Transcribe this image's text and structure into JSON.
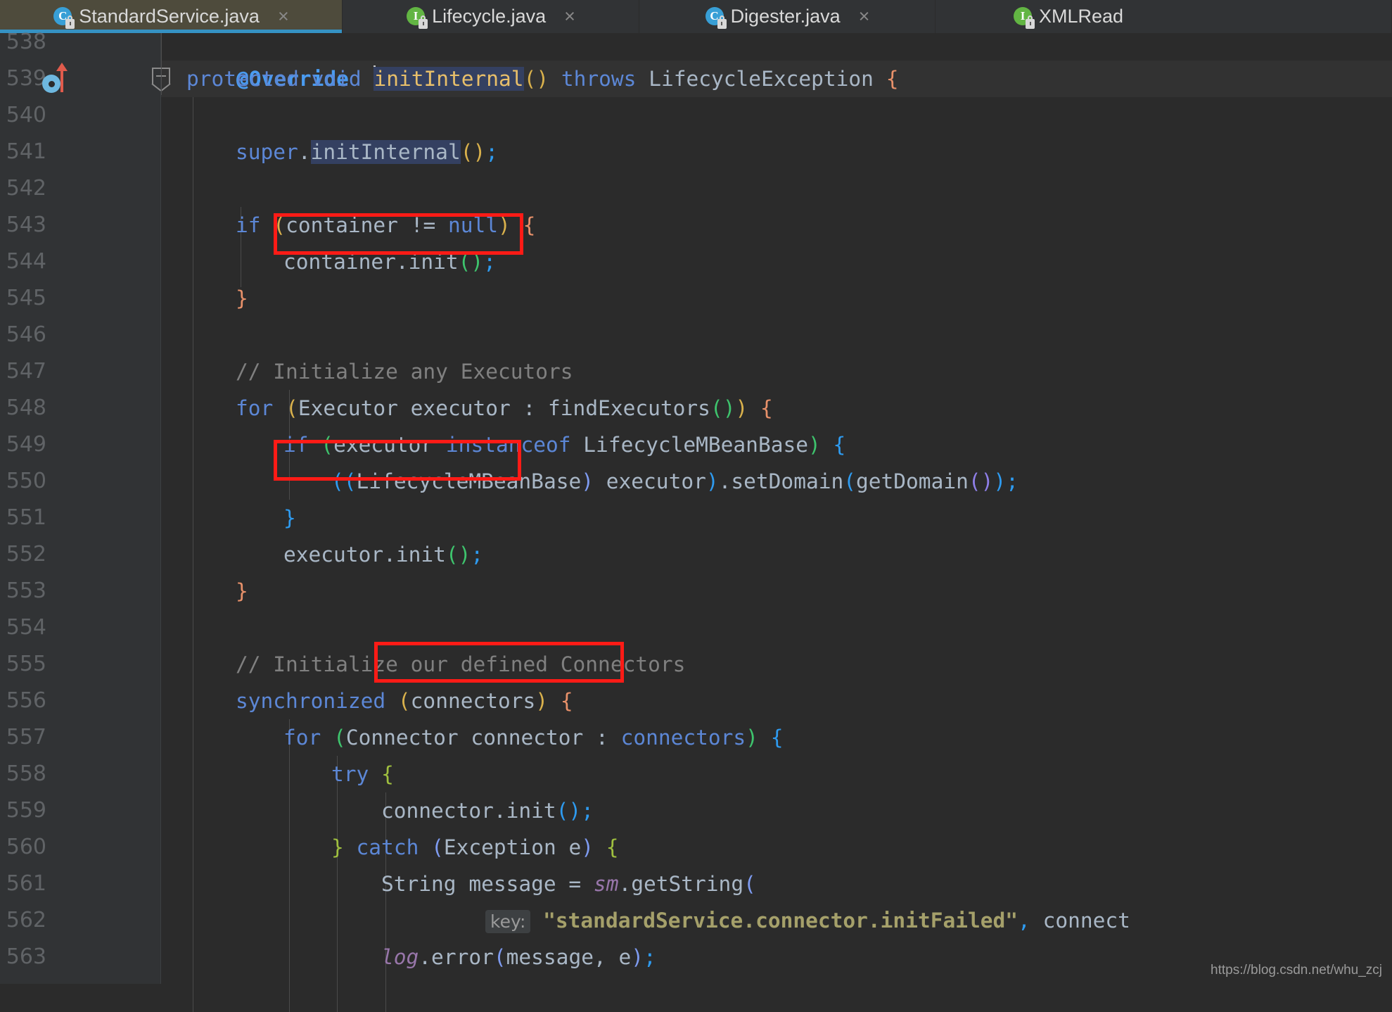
{
  "window": {
    "app": "IntelliJ IDEA",
    "theme_background": "#2b2b2b"
  },
  "tabs": [
    {
      "label": "StandardService.java",
      "icon": "java-class-icon",
      "icon_letter": "C",
      "icon_color": "#389fd6",
      "locked": true,
      "active": true,
      "close_label": "×"
    },
    {
      "label": "Lifecycle.java",
      "icon": "java-interface-icon",
      "icon_letter": "I",
      "icon_color": "#62b543",
      "locked": true,
      "active": false,
      "close_label": "×"
    },
    {
      "label": "Digester.java",
      "icon": "java-class-icon",
      "icon_letter": "C",
      "icon_color": "#389fd6",
      "locked": true,
      "active": false,
      "close_label": "×"
    },
    {
      "label": "XMLRead",
      "icon": "java-interface-icon",
      "icon_letter": "I",
      "icon_color": "#62b543",
      "locked": true,
      "active": false,
      "close_label": ""
    }
  ],
  "editor": {
    "file": "StandardService.java",
    "caret_line": 539,
    "selection_highlight_token": "initInternal",
    "gutter": {
      "override_marker_line": 539,
      "override_marker_name": "overriding-method-marker",
      "fold_marker_line": 539
    },
    "line_numbers": [
      "538",
      "539",
      "540",
      "541",
      "542",
      "543",
      "544",
      "545",
      "546",
      "547",
      "548",
      "549",
      "550",
      "551",
      "552",
      "553",
      "554",
      "555",
      "556",
      "557",
      "558",
      "559",
      "560",
      "561",
      "562",
      "563"
    ],
    "lines": [
      {
        "n": "538",
        "indent": 2,
        "text": "@Override"
      },
      {
        "n": "539",
        "indent": 2,
        "text": "protected void initInternal() throws LifecycleException {"
      },
      {
        "n": "540",
        "indent": 0,
        "text": ""
      },
      {
        "n": "541",
        "indent": 3,
        "text": "super.initInternal();"
      },
      {
        "n": "542",
        "indent": 0,
        "text": ""
      },
      {
        "n": "543",
        "indent": 3,
        "text": "if (container != null) {"
      },
      {
        "n": "544",
        "indent": 4,
        "text": "container.init();"
      },
      {
        "n": "545",
        "indent": 3,
        "text": "}"
      },
      {
        "n": "546",
        "indent": 0,
        "text": ""
      },
      {
        "n": "547",
        "indent": 3,
        "text": "// Initialize any Executors"
      },
      {
        "n": "548",
        "indent": 3,
        "text": "for (Executor executor : findExecutors()) {"
      },
      {
        "n": "549",
        "indent": 4,
        "text": "if (executor instanceof LifecycleMBeanBase) {"
      },
      {
        "n": "550",
        "indent": 5,
        "text": "((LifecycleMBeanBase) executor).setDomain(getDomain());"
      },
      {
        "n": "551",
        "indent": 4,
        "text": "}"
      },
      {
        "n": "552",
        "indent": 4,
        "text": "executor.init();"
      },
      {
        "n": "553",
        "indent": 3,
        "text": "}"
      },
      {
        "n": "554",
        "indent": 0,
        "text": ""
      },
      {
        "n": "555",
        "indent": 3,
        "text": "// Initialize our defined Connectors"
      },
      {
        "n": "556",
        "indent": 3,
        "text": "synchronized (connectors) {"
      },
      {
        "n": "557",
        "indent": 4,
        "text": "for (Connector connector : connectors) {"
      },
      {
        "n": "558",
        "indent": 5,
        "text": "try {"
      },
      {
        "n": "559",
        "indent": 6,
        "text": "connector.init();"
      },
      {
        "n": "560",
        "indent": 5,
        "text": "} catch (Exception e) {"
      },
      {
        "n": "561",
        "indent": 6,
        "text": "String message = sm.getString("
      },
      {
        "n": "562",
        "indent": 8,
        "text": "key: \"standardService.connector.initFailed\", connect"
      },
      {
        "n": "563",
        "indent": 6,
        "text": "log.error(message, e);"
      }
    ],
    "inlay_hints": [
      {
        "line": "562",
        "label": "key:"
      }
    ],
    "annotations": [
      {
        "name": "highlight-box-container-init",
        "line": "544",
        "target": "container.init();"
      },
      {
        "name": "highlight-box-executor-init",
        "line": "552",
        "target": "executor.init();"
      },
      {
        "name": "highlight-box-connector-init",
        "line": "559",
        "target": "connector.init();"
      }
    ],
    "annotation_color": "#fe1b16"
  },
  "watermark": {
    "text": "https://blog.csdn.net/whu_zcj"
  }
}
